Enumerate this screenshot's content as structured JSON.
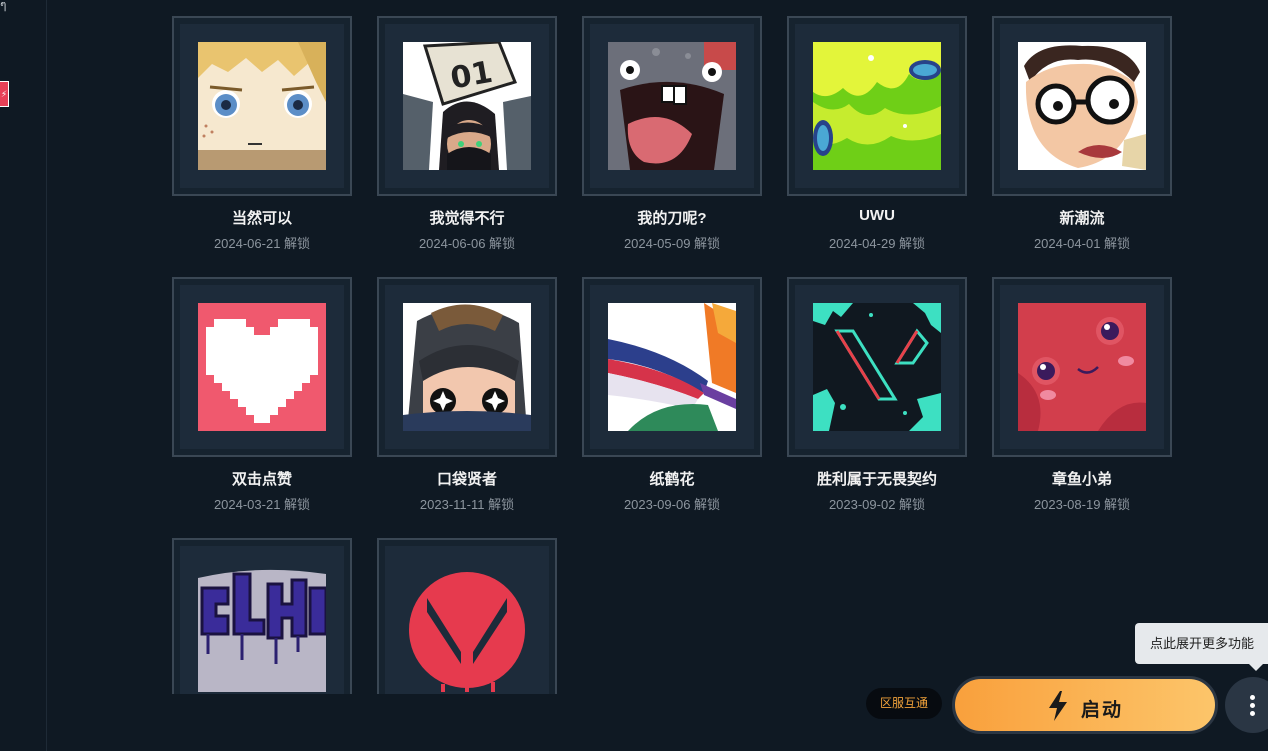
{
  "sidebar": {
    "top_glyph": "ๆ",
    "badge_glyph": "⚡"
  },
  "items": [
    {
      "name": "当然可以",
      "date": "2024-06-21 解锁",
      "icon": "cartoon-face-blond-icon"
    },
    {
      "name": "我觉得不行",
      "date": "2024-06-06 解锁",
      "icon": "agent-holding-sign-icon"
    },
    {
      "name": "我的刀呢?",
      "date": "2024-05-09 解锁",
      "icon": "screaming-creature-icon"
    },
    {
      "name": "UWU",
      "date": "2024-04-29 解锁",
      "icon": "green-slime-icon"
    },
    {
      "name": "新潮流",
      "date": "2024-04-01 解锁",
      "icon": "glasses-face-icon"
    },
    {
      "name": "双击点赞",
      "date": "2024-03-21 解锁",
      "icon": "pixel-heart-icon"
    },
    {
      "name": "口袋贤者",
      "date": "2023-11-11 解锁",
      "icon": "peeking-agent-icon"
    },
    {
      "name": "纸鹤花",
      "date": "2023-09-06 解锁",
      "icon": "paper-crane-flower-icon"
    },
    {
      "name": "胜利属于无畏契约",
      "date": "2023-09-02 解锁",
      "icon": "valorant-logo-splatter-icon"
    },
    {
      "name": "章鱼小弟",
      "date": "2023-08-19 解锁",
      "icon": "octopus-tentacle-icon"
    },
    {
      "name": "",
      "date": "",
      "icon": "graffiti-tag-icon"
    },
    {
      "name": "",
      "date": "",
      "icon": "valorant-red-circle-icon"
    }
  ],
  "tooltip": "点此展开更多功能",
  "region_badge": "区服互通",
  "launch_button": {
    "label": "启动",
    "icon": "lightning-bolt-icon"
  },
  "more_button": {
    "icon": "vertical-dots-icon"
  }
}
